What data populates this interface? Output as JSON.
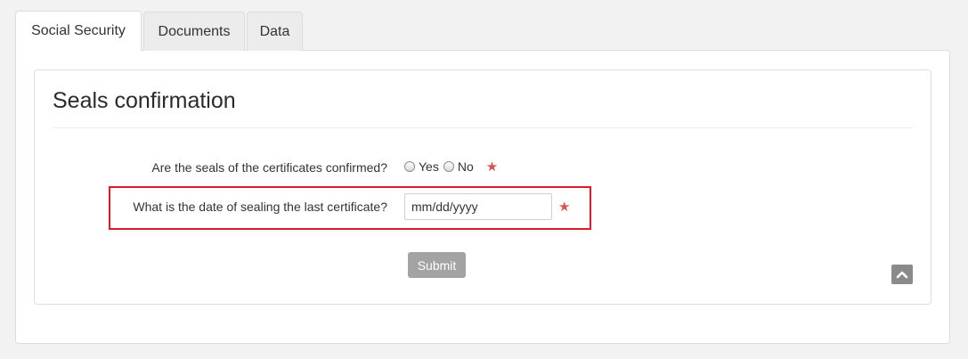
{
  "tabs": [
    {
      "label": "Social Security",
      "active": true
    },
    {
      "label": "Documents",
      "active": false
    },
    {
      "label": "Data",
      "active": false
    }
  ],
  "card": {
    "title": "Seals confirmation"
  },
  "form": {
    "q1_label": "Are the seals of the certificates confirmed?",
    "q1_options": [
      "Yes",
      "No"
    ],
    "q2_label": "What is the date of sealing the last certificate?",
    "date_placeholder": "mm/dd/yyyy",
    "required_mark": "★",
    "submit_label": "Submit"
  },
  "colors": {
    "required_star": "#d9534f",
    "highlight": "#e0192a",
    "submit_bg": "#a3a3a3"
  },
  "icons": {
    "scroll_top": "chevron-up-icon"
  }
}
